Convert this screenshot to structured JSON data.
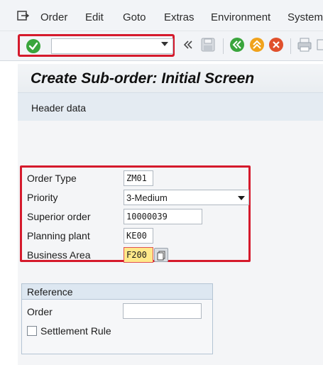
{
  "menu": {
    "items": [
      {
        "label": "Order"
      },
      {
        "label": "Edit"
      },
      {
        "label": "Goto"
      },
      {
        "label": "Extras"
      },
      {
        "label": "Environment"
      },
      {
        "label": "System"
      }
    ],
    "icon": "exit-menu-icon"
  },
  "toolbar": {
    "enter_icon": "green-check-icon",
    "command_field_value": "",
    "icons": [
      "double-chevron-left-icon",
      "save-icon",
      "back-icon",
      "exit-icon",
      "cancel-icon",
      "print-icon",
      "find-icon"
    ]
  },
  "screen": {
    "title": "Create Sub-order: Initial Screen",
    "appbar_button": "Header data"
  },
  "form": {
    "order_type": {
      "label": "Order Type",
      "value": "ZM01"
    },
    "priority": {
      "label": "Priority",
      "value": "3-Medium"
    },
    "superior_order": {
      "label": "Superior order",
      "value": "10000039"
    },
    "planning_plant": {
      "label": "Planning plant",
      "value": "KE00"
    },
    "business_area": {
      "label": "Business Area",
      "value": "F200"
    }
  },
  "reference": {
    "title": "Reference",
    "order_label": "Order",
    "order_value": "",
    "settlement_rule_label": "Settlement Rule",
    "settlement_rule_checked": false
  },
  "colors": {
    "highlight_red": "#d51a2c",
    "enter_green": "#3aa53c",
    "focus_yellow": "#ffe98a"
  }
}
